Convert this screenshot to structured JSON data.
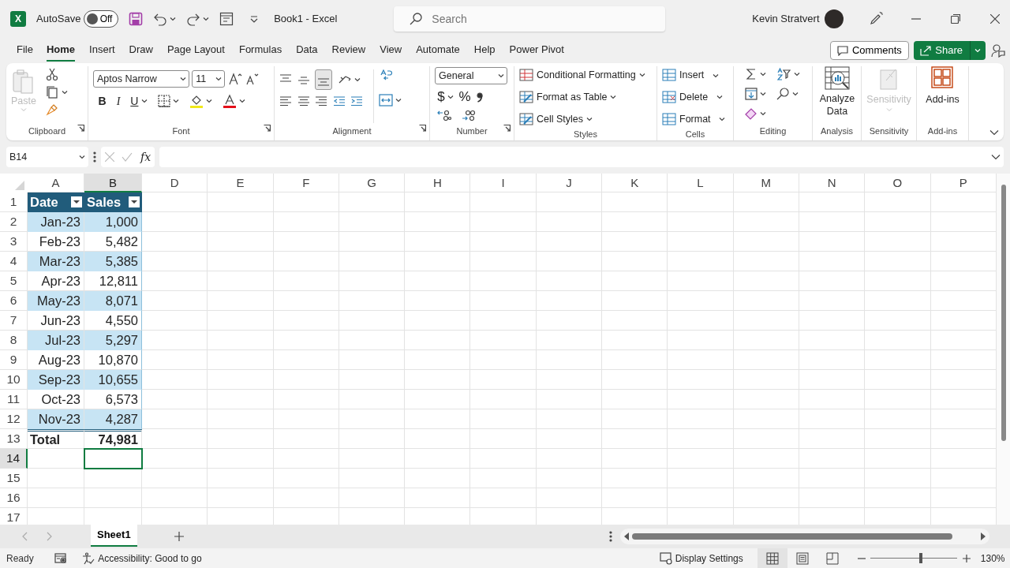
{
  "title_bar": {
    "app_icon_letter": "X",
    "autosave_label": "AutoSave",
    "autosave_toggle": {
      "label": "Off",
      "on": false
    },
    "document_title": "Book1  -  Excel",
    "search": {
      "placeholder": "Search"
    },
    "user_name": "Kevin Stratvert"
  },
  "ribbon_tabs": [
    {
      "label": "File",
      "selected": false
    },
    {
      "label": "Home",
      "selected": true
    },
    {
      "label": "Insert",
      "selected": false
    },
    {
      "label": "Draw",
      "selected": false
    },
    {
      "label": "Page Layout",
      "selected": false
    },
    {
      "label": "Formulas",
      "selected": false
    },
    {
      "label": "Data",
      "selected": false
    },
    {
      "label": "Review",
      "selected": false
    },
    {
      "label": "View",
      "selected": false
    },
    {
      "label": "Automate",
      "selected": false
    },
    {
      "label": "Help",
      "selected": false
    },
    {
      "label": "Power Pivot",
      "selected": false
    }
  ],
  "comments_button": "Comments",
  "share_button": "Share",
  "ribbon": {
    "clipboard": {
      "paste": {
        "label": "Paste",
        "disabled": true
      },
      "group_label": "Clipboard"
    },
    "font": {
      "font_name": "Aptos Narrow",
      "font_size": "11",
      "bold": "B",
      "italic": "I",
      "underline": "U",
      "group_label": "Font"
    },
    "alignment": {
      "group_label": "Alignment"
    },
    "number": {
      "format": "General",
      "currency": "$",
      "percent": "%",
      "group_label": "Number"
    },
    "styles": {
      "items": [
        "Conditional Formatting",
        "Format as Table",
        "Cell Styles"
      ],
      "group_label": "Styles"
    },
    "cells": {
      "items": [
        "Insert",
        "Delete",
        "Format"
      ],
      "group_label": "Cells"
    },
    "editing": {
      "group_label": "Editing"
    },
    "analysis": {
      "button": "Analyze Data",
      "group_label": "Analysis"
    },
    "sensitivity": {
      "button": {
        "label": "Sensitivity",
        "disabled": true
      },
      "group_label": "Sensitivity"
    },
    "addins": {
      "button": "Add-ins",
      "group_label": "Add-ins"
    }
  },
  "formula_bar": {
    "name_box": "B14",
    "function_label": "fx"
  },
  "columns": [
    {
      "label": "A",
      "selected": false
    },
    {
      "label": "B",
      "selected": true
    },
    {
      "label": "D",
      "selected": false
    },
    {
      "label": "E",
      "selected": false
    },
    {
      "label": "F",
      "selected": false
    },
    {
      "label": "G",
      "selected": false
    },
    {
      "label": "H",
      "selected": false
    },
    {
      "label": "I",
      "selected": false
    },
    {
      "label": "J",
      "selected": false
    },
    {
      "label": "K",
      "selected": false
    },
    {
      "label": "L",
      "selected": false
    },
    {
      "label": "M",
      "selected": false
    },
    {
      "label": "N",
      "selected": false
    },
    {
      "label": "O",
      "selected": false
    },
    {
      "label": "P",
      "selected": false
    }
  ],
  "rows": [
    {
      "label": "1",
      "selected": false
    },
    {
      "label": "2",
      "selected": false
    },
    {
      "label": "3",
      "selected": false
    },
    {
      "label": "4",
      "selected": false
    },
    {
      "label": "5",
      "selected": false
    },
    {
      "label": "6",
      "selected": false
    },
    {
      "label": "7",
      "selected": false
    },
    {
      "label": "8",
      "selected": false
    },
    {
      "label": "9",
      "selected": false
    },
    {
      "label": "10",
      "selected": false
    },
    {
      "label": "11",
      "selected": false
    },
    {
      "label": "12",
      "selected": false
    },
    {
      "label": "13",
      "selected": false
    },
    {
      "label": "14",
      "selected": true
    },
    {
      "label": "15",
      "selected": false
    },
    {
      "label": "16",
      "selected": false
    },
    {
      "label": "17",
      "selected": false
    }
  ],
  "table": {
    "headers": [
      "Date",
      "Sales"
    ],
    "rows": [
      [
        "Jan-23",
        "1,000"
      ],
      [
        "Feb-23",
        "5,482"
      ],
      [
        "Mar-23",
        "5,385"
      ],
      [
        "Apr-23",
        "12,811"
      ],
      [
        "May-23",
        "8,071"
      ],
      [
        "Jun-23",
        "4,550"
      ],
      [
        "Jul-23",
        "5,297"
      ],
      [
        "Aug-23",
        "10,870"
      ],
      [
        "Sep-23",
        "10,655"
      ],
      [
        "Oct-23",
        "6,573"
      ],
      [
        "Nov-23",
        "4,287"
      ]
    ],
    "total": [
      "Total",
      "74,981"
    ]
  },
  "sheet_tabs": [
    {
      "label": "Sheet1",
      "selected": true
    }
  ],
  "status_bar": {
    "ready": "Ready",
    "accessibility": "Accessibility: Good to go",
    "display_settings": "Display Settings",
    "views": [
      {
        "kind": "normal",
        "selected": true
      },
      {
        "kind": "page-layout",
        "selected": false
      },
      {
        "kind": "page-break",
        "selected": false
      }
    ],
    "zoom": {
      "level": 0.58,
      "reading": "130%"
    }
  }
}
